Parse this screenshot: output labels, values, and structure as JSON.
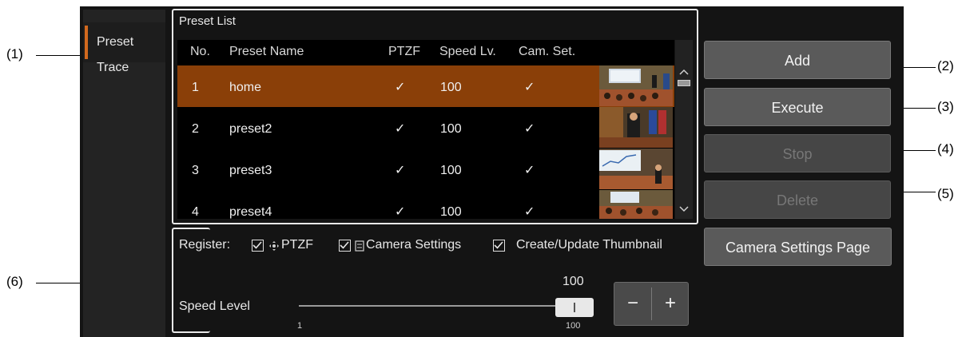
{
  "callouts": [
    "(1)",
    "(2)",
    "(3)",
    "(4)",
    "(5)",
    "(6)"
  ],
  "sidebar": {
    "tabs": [
      {
        "label": "Preset"
      },
      {
        "label": "Trace"
      }
    ]
  },
  "preset_list": {
    "title": "Preset List",
    "headers": [
      "No.",
      "Preset Name",
      "PTZF",
      "Speed Lv.",
      "Cam. Set."
    ],
    "rows": [
      {
        "no": "1",
        "name": "home",
        "ptzf": "✓",
        "speed": "100",
        "camset": "✓"
      },
      {
        "no": "2",
        "name": "preset2",
        "ptzf": "✓",
        "speed": "100",
        "camset": "✓"
      },
      {
        "no": "3",
        "name": "preset3",
        "ptzf": "✓",
        "speed": "100",
        "camset": "✓"
      },
      {
        "no": "4",
        "name": "preset4",
        "ptzf": "✓",
        "speed": "100",
        "camset": "✓"
      }
    ]
  },
  "buttons": {
    "add": "Add",
    "execute": "Execute",
    "stop": "Stop",
    "delete": "Delete",
    "camera_settings_page": "Camera Settings Page"
  },
  "register": {
    "label": "Register:",
    "ptzf": "PTZF",
    "camera_settings": "Camera Settings",
    "thumbnail": "Create/Update Thumbnail"
  },
  "speed": {
    "label": "Speed Level",
    "value": "100",
    "min": "1",
    "max": "100",
    "minus": "−",
    "plus": "+"
  },
  "colors": {
    "selected_row": "#8a3f08",
    "accent": "#d2691e"
  }
}
